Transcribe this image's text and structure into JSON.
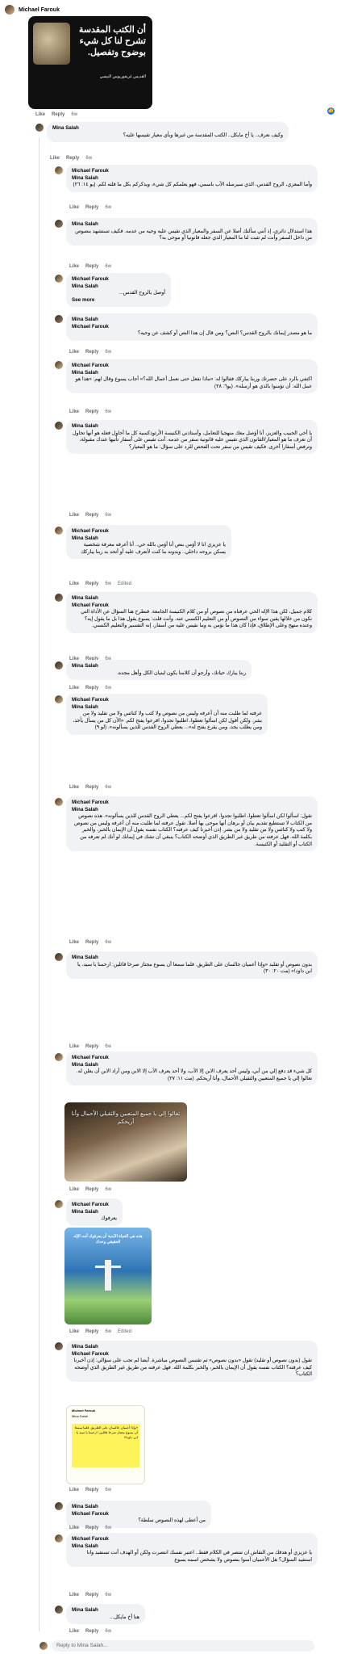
{
  "post": {
    "author": "Michael Farouk",
    "image_title": "أن الكتب المقدسة تشرح لنا كل شيء بوضوح وتفصيل.",
    "image_caption": "القديس غريغوريوس النيصي",
    "actions": {
      "like": "Like",
      "reply": "Reply",
      "time": "6w"
    }
  },
  "comments": [
    {
      "author": "Mina Salah",
      "tag": "",
      "text": "وكيف نعرف.. يا أخ مايكل.. الكتب المقدسة من غيرها وبأي معيار تقيسها عليه؟",
      "time": "6w"
    },
    {
      "author": "Michael Farouk",
      "tag": "Mina Salah",
      "text": "وأما المعزي، الروح القدس، الذي سيرسله الآب باسمي، فهو يعلمكم كل شيء، ويذكركم بكل ما قلته لكم. (يو ١٤: ٢٦)",
      "time": "6w"
    },
    {
      "author": "Mina Salah",
      "tag": "",
      "text": "هذا استدلال دائري، إذ أنني سألتك أصلا عن السفر والمعيار الذي تقيس عليه وحيه من عدمه. فكيف تستشهد بنصوص من داخل السفر وأنت لم تثبت لنا ما المعيار الذي جعله قانونيا أو موحى به؟",
      "time": "6w"
    },
    {
      "author": "Michael Farouk",
      "tag": "Mina Salah",
      "text": "أوصل بالروح القدس...",
      "more": "See more",
      "time": "6w"
    },
    {
      "author": "Mina Salah",
      "tag": "Michael Farouk",
      "text": "ما هو مصدر إيمانك بالروح القدس؟ النص؟ ومن قال إن هذا النص أو كشف عن وحيه؟",
      "time": "6w"
    },
    {
      "author": "Michael Farouk",
      "tag": "Mina Salah",
      "text": "اكتفي بالرد على حضرتك وربنا يباركك فقالوا له: «ماذا نفعل حتى نعمل أعمال الله؟» أجاب يسوع وقال لهم: «هذا هو عمل الله: أن تؤمنوا بالذي هو أرسله». (يو٦: ٢٨)",
      "time": "6w"
    },
    {
      "author": "Mina Salah",
      "tag": "",
      "text": "يا أخي الحبيب والعزيز، أنا أؤصل معك منهجيا للتعامل، وأستاذني الكنيسة الأرثوذكسية كل ما أحاول فعله هو أنها تحاول أن تعرف ما هو المعيار/القانون الذي تقيس عليه قانونية سفر من عدمه. أنت تقيس على أسفار تأتيها عندك مقبولة، وترفض أسفارا أخرى. فكيف تقيس من سفر تحت الفحص للرد على سؤال: ما هو المعيار؟",
      "time": "6w"
    },
    {
      "author": "Michael Farouk",
      "tag": "Mina Salah",
      "text": "يا عزيزي انا لا أؤمن بنص أنا أؤمن بالله حي.. أنا أعرفه معرفة شخصية يسكن بروحه داخلي.. وبدونه ما كنت لأتعرف عليه أو أتحد به ربنا يباركك",
      "time": "6w",
      "edited": "Edited"
    },
    {
      "author": "Mina Salah",
      "tag": "Michael Farouk",
      "text": "كلام جميل، لكن هذا الإله الحي عرفناه من نصوص أو من كلام الكنيسة الجامعة. فنطرح هنا السؤال عن الأداة التي نكون من خلالها يقين سواء من النصوص أو من التعليم الكنسي عنه. وأنت قلت: يسوع يقول هذا بل ما يقول إيه؟ وعنده منهج وعلى الإطلاق، فإذا كان هذا ما نؤمن به وما نقيس عليه من أسفار، إنه التفسير والتعليم الكنسي.",
      "time": "6w"
    },
    {
      "author": "Mina Salah",
      "tag": "",
      "text": "ربنا يبارك حياتك، وأرجو أن كلامنا يكون لبنيان الكل وأهل مجده.",
      "time": "6w"
    },
    {
      "author": "Michael Farouk",
      "tag": "Mina Salah",
      "text": "عرفته لما طلبت منه أن أعرفه وليس من نصوص ولا كتب ولا كنائس ولا من تقليد ولا من بشر. ولكن أقول لكن اسألوا تعطوا، اطلبوا تجدوا، اقرعوا يفتح لكم. «الآن كل من يسأل يأخذ، ومن يطلب يجد، ومن يقرع يفتح له»... يعطي الروح القدس للذين يسألونه». (لو ٩)",
      "time": "6w"
    },
    {
      "author": "Michael Farouk",
      "tag": "Mina Salah",
      "text": "تقول: اسألوا لكن اسألوا تعطوا، اطلبوا تجدوا، اقرعوا يفتح لكم... يعطي الروح القدس للذين يسألونه». هذه نصوص من الكتاب لا تستطيع تقديم بيان أو برهان أنها موحى بها أصلا. تقول عرفته لما طلبت منه أن أعرفه وليس من نصوص ولا كتب ولا كنائس ولا من تقليد ولا من بشر. إذن أخبرنا كيف عرفته؟ الكتاب نفسه يقول أن الإيمان بالخبر، والخبر بكلمة الله. فهل عرفته من طريق غير الطريق الذي أوضحه الكتاب؟ ينبغي أن تشك في إيمانك لو أنك لم تعرفه من الكتاب أو التقليد أو الكنيسة.",
      "time": "6w"
    },
    {
      "author": "Mina Salah",
      "tag": "",
      "text": "بدون نصوص أو تقليد «وإذا أعميان جالسان على الطريق. فلما سمعا أن يسوع مجتاز صرخا قائلين: ارحمنا يا سيد، يا ابن داود!» (مت ٢٠: ٣٠)",
      "time": "6w"
    },
    {
      "author": "Michael Farouk",
      "tag": "Mina Salah",
      "text": "كل شيء قد دفع إلي من أبي، وليس أحد يعرف الابن إلا الآب، ولا أحد يعرف الآب إلا الابن ومن أراد الابن أن يعلن له. تعالوا إلي يا جميع المتعبين والثقيلي الأحمال، وأنا أريحكم. (مت ١١: ٢٧)",
      "time": "6w"
    },
    {
      "author": "Michael Farouk",
      "tag": "Mina Salah",
      "text": "يعرفوك",
      "time": "6w",
      "edited": "Edited"
    },
    {
      "author": "Mina Salah",
      "tag": "Michael Farouk",
      "text": "تقول (بدون نصوص أو تقليد) تقول «بدون نصوص» ثم تقتبس النصوص مباشرة. أيضا لم تجب على سؤالي: إذن أخبرنا كيف عرفته؟ الكتاب نفسه يقول أن الإيمان بالخبر، والخبر بكلمة الله. فهل عرفته من طريق غير الطريق الذي أوضحه الكتاب؟",
      "time": "6w"
    },
    {
      "author": "Mina Salah",
      "tag": "Michael Farouk",
      "text": "من أعطى لهذه النصوص سلطة؟",
      "time": "6w"
    },
    {
      "author": "Michael Farouk",
      "tag": "Mina Salah",
      "text": "يا عزيزي أو هدفك من النقاش ان تنتصر في الكلام فقط.. اعتبر نفسك انتصرت ولكن أو الهدف أنت تستفيد وانا استفيد السؤال؟ هل الأعميان آمنوا بنصوص ولا بشخص اسمه يسوع",
      "time": "6w"
    },
    {
      "author": "Mina Salah",
      "tag": "Michael Farouk",
      "text": "هنا أخ مايكل...",
      "time": "6w"
    }
  ],
  "images": {
    "img1_text": "تعالوا إلي يا جميع المتعبين والثقيلي الأحمال وأنا أريحكم",
    "img2_text": "هذه هي الحياة الأبدية أن يعرفوك أنت الإله الحقيقي وحدك",
    "img3_header": "Michael Farouk",
    "img3_sub": "Mina Salah",
    "img3_text": "«وإذا أعميان جالسان على الطريق. فلما سمعا أن يسوع مجتاز صرخا قائلين: ارحمنا يا سيد يا ابن داود!»"
  },
  "ui": {
    "like": "Like",
    "reply": "Reply",
    "reply_placeholder": "Reply to Mina Salah..."
  }
}
